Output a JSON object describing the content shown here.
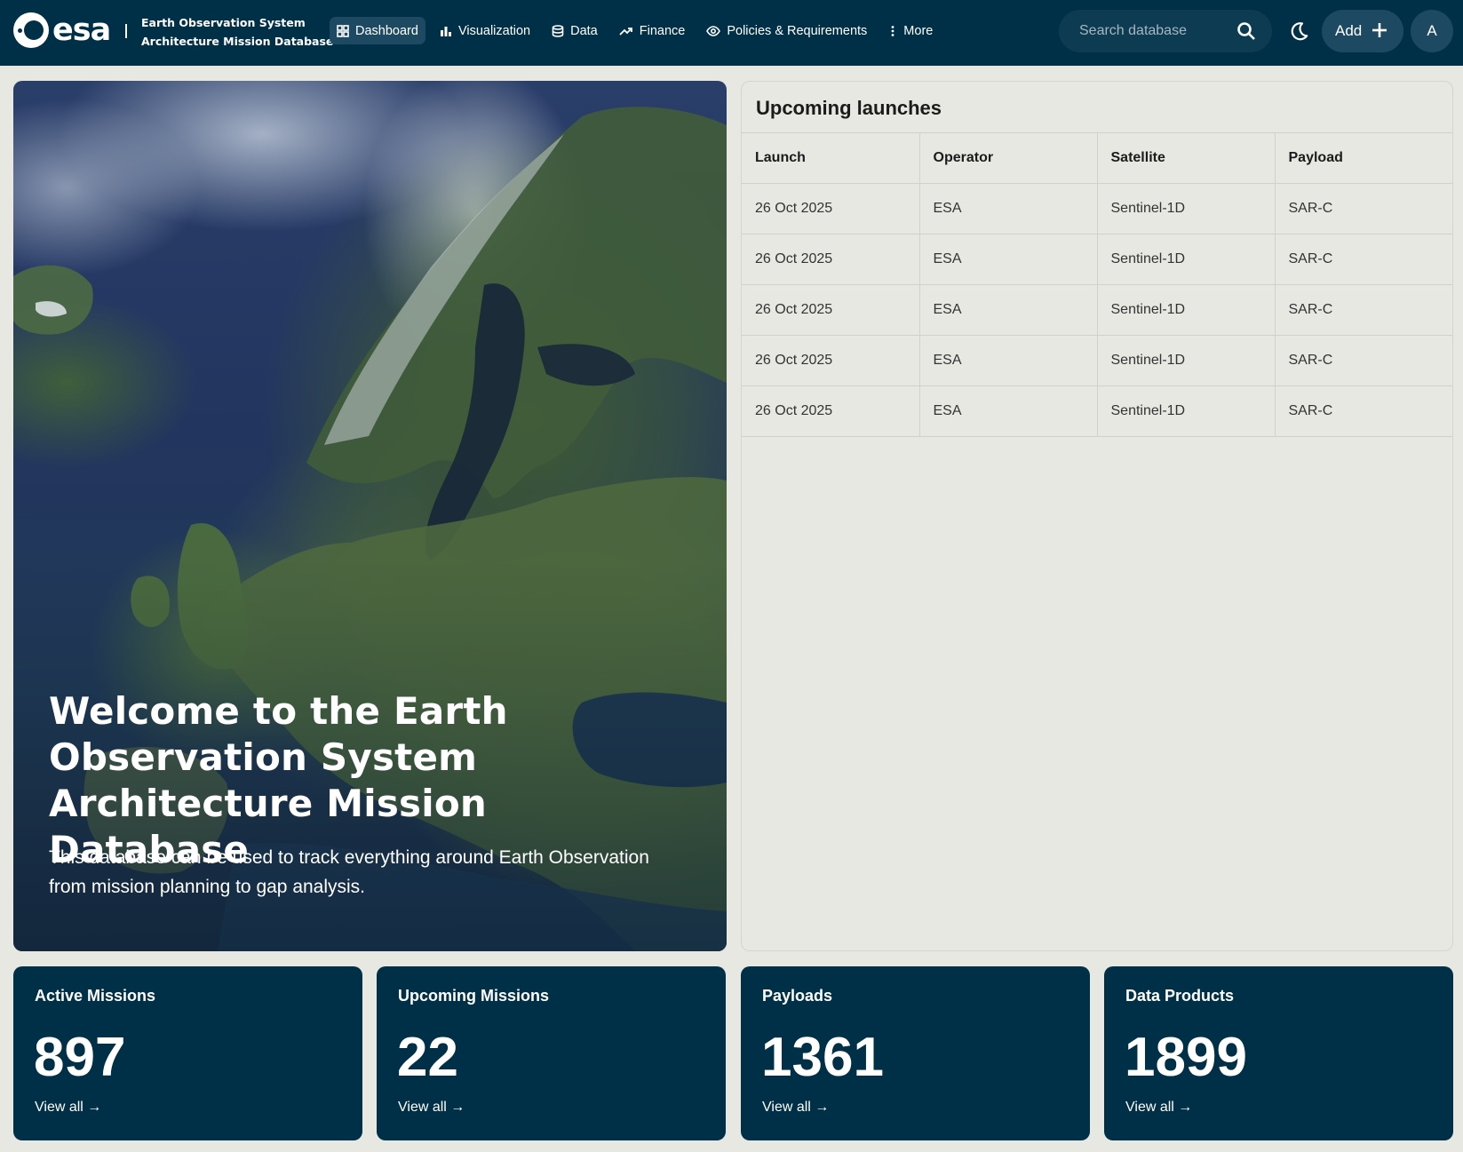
{
  "brand": {
    "logo_text": "esa",
    "system_title_line1": "Earth Observation System",
    "system_title_line2": "Architecture Mission Database"
  },
  "nav": [
    {
      "label": "Dashboard",
      "icon": "dashboard-icon",
      "active": true
    },
    {
      "label": "Visualization",
      "icon": "bar-chart-icon",
      "active": false
    },
    {
      "label": "Data",
      "icon": "database-icon",
      "active": false
    },
    {
      "label": "Finance",
      "icon": "trend-up-icon",
      "active": false
    },
    {
      "label": "Policies & Requirements",
      "icon": "eye-icon",
      "active": false
    },
    {
      "label": "More",
      "icon": "more-vertical-icon",
      "active": false
    }
  ],
  "search": {
    "placeholder": "Search database",
    "value": ""
  },
  "add_button": {
    "label": "Add"
  },
  "avatar": {
    "initial": "A"
  },
  "hero": {
    "title": "Welcome to the Earth Observation System Architecture Mission Database",
    "subtitle": "This database can be used to track everything around Earth Observation from mission planning to gap analysis."
  },
  "launches": {
    "title": "Upcoming launches",
    "columns": [
      "Launch",
      "Operator",
      "Satellite",
      "Payload"
    ],
    "rows": [
      [
        "26 Oct 2025",
        "ESA",
        "Sentinel-1D",
        "SAR-C"
      ],
      [
        "26 Oct 2025",
        "ESA",
        "Sentinel-1D",
        "SAR-C"
      ],
      [
        "26 Oct 2025",
        "ESA",
        "Sentinel-1D",
        "SAR-C"
      ],
      [
        "26 Oct 2025",
        "ESA",
        "Sentinel-1D",
        "SAR-C"
      ],
      [
        "26 Oct 2025",
        "ESA",
        "Sentinel-1D",
        "SAR-C"
      ]
    ]
  },
  "stats": [
    {
      "title": "Active Missions",
      "value": "897",
      "link": "View all →"
    },
    {
      "title": "Upcoming Missions",
      "value": "22",
      "link": "View all →"
    },
    {
      "title": "Payloads",
      "value": "1361",
      "link": "View all →"
    },
    {
      "title": "Data Products",
      "value": "1899",
      "link": "View all →"
    }
  ],
  "colors": {
    "header_bg": "#003047",
    "accent": "#1d4a62",
    "page_bg": "#e8e8e3",
    "card_bg": "#003047"
  }
}
